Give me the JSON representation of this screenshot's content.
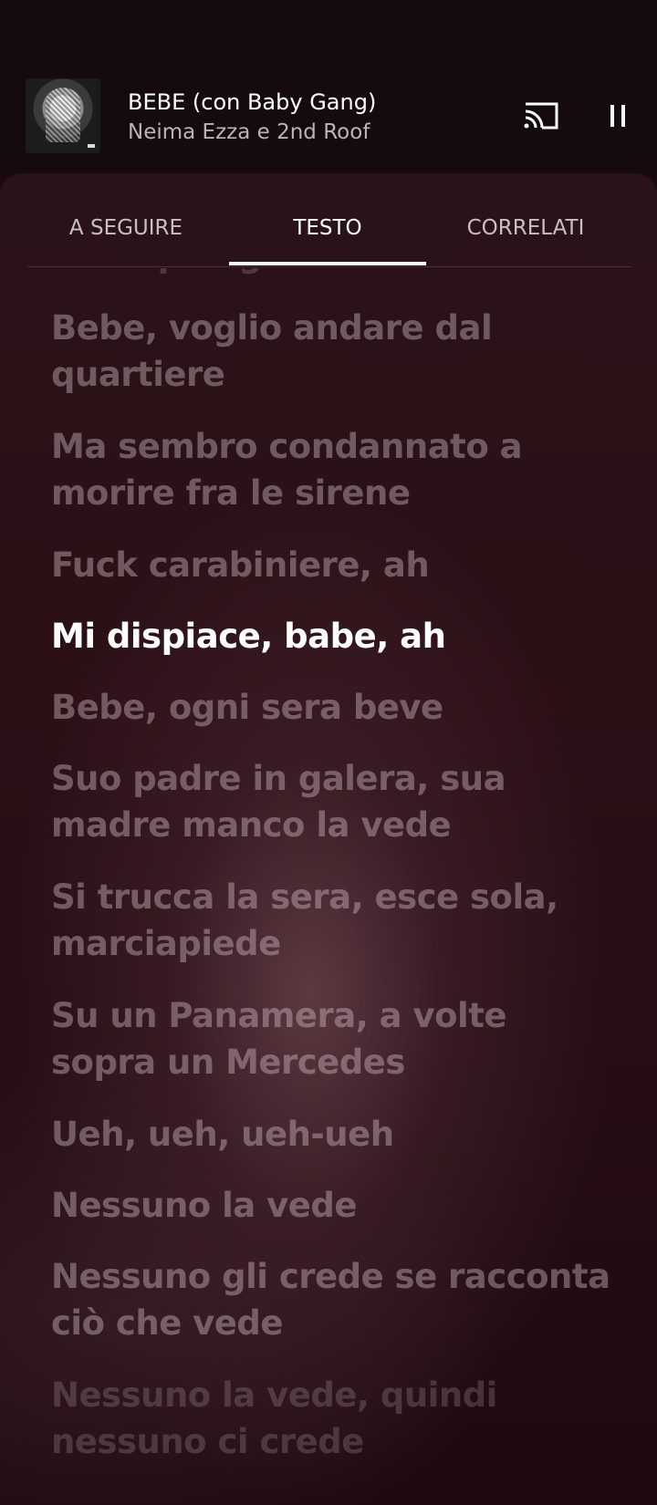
{
  "now_playing": {
    "title": "BEBE (con Baby Gang)",
    "artist": "Neima Ezza e 2nd Roof"
  },
  "controls": {
    "cast_icon": "cast-icon",
    "pause_icon": "pause-icon"
  },
  "tabs": [
    {
      "label": "A SEGUIRE",
      "active": false
    },
    {
      "label": "TESTO",
      "active": true
    },
    {
      "label": "CORRELATI",
      "active": false
    }
  ],
  "lyrics": {
    "partial_top": "E ora piangi tutte le sere",
    "lines": [
      "Bebe, voglio andare dal quartiere",
      "Ma sembro condannato a morire fra le sirene",
      "Fuck carabiniere, ah",
      "Mi dispiace, babe, ah",
      "Bebe, ogni sera beve",
      "Suo padre in galera, sua madre manco la vede",
      "Si trucca la sera, esce sola, marciapiede",
      "Su un Panamera, a volte sopra un Mercedes",
      "Ueh, ueh, ueh-ueh",
      "Nessuno la vede",
      "Nessuno gli crede se racconta ciò che vede",
      "Nessuno la vede, quindi nessuno ci crede"
    ],
    "current_index": 3
  },
  "colors": {
    "accent_text": "#ffffff",
    "dim_text": "#c9bfc2",
    "background": "#2a1318"
  }
}
